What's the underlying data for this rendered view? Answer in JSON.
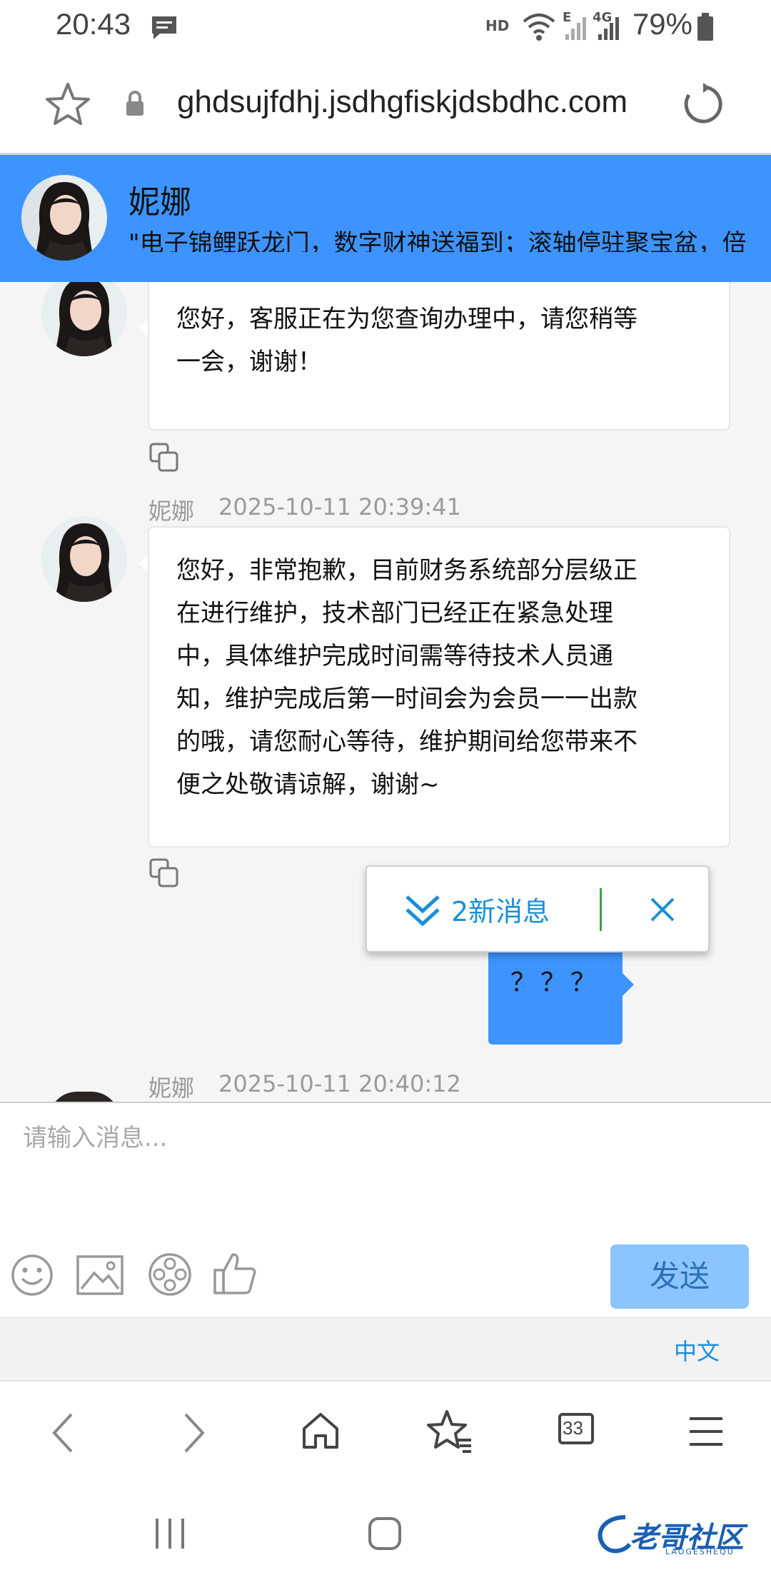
{
  "status_bar": {
    "time": "20:43",
    "network_label": "HD",
    "network_type_label": "4G",
    "edge_label": "E",
    "battery_percent": "79%"
  },
  "url_bar": {
    "url": "ghdsujfdhj.jsdhgfiskjdsbdhc.com"
  },
  "chat_header": {
    "agent_name": "妮娜",
    "marquee_text": "\"电子锦鲤跃龙门，数字财神送福到；滚轴停驻聚宝盆，倍"
  },
  "messages": [
    {
      "sender": "妮娜",
      "timestamp": "",
      "text": "您好，客服正在为您查询办理中，请您稍等一会，谢谢！",
      "lines": [
        "您好，客服正在为您查询办理中，请您稍等",
        "一会，谢谢！"
      ]
    },
    {
      "sender": "妮娜",
      "timestamp": "2025-10-11 20:39:41",
      "text": "您好，非常抱歉，目前财务系统部分层级正在进行维护，技术部门已经正在紧急处理中，具体维护完成时间需等待技术人员通知，维护完成后第一时间会为会员一一出款的哦，请您耐心等待，维护期间给您带来不便之处敬请谅解，谢谢~",
      "lines": [
        "您好，非常抱歉，目前财务系统部分层级正",
        "在进行维护，技术部门已经正在紧急处理",
        "中，具体维护完成时间需等待技术人员通",
        "知，维护完成后第一时间会为会员一一出款",
        "的哦，请您耐心等待，维护期间给您带来不",
        "便之处敬请谅解，谢谢~"
      ]
    },
    {
      "sender": "me",
      "text": "？？？"
    },
    {
      "sender": "妮娜",
      "timestamp": "2025-10-11 20:40:12"
    }
  ],
  "new_message_pill": {
    "label": "2新消息"
  },
  "composer": {
    "placeholder": "请输入消息...",
    "send_label": "发送"
  },
  "language": {
    "label": "中文"
  },
  "browser_toolbar": {
    "tabs_count": "33"
  },
  "watermark": {
    "text": "老哥社区",
    "subtext": "LAOGESHEQU"
  },
  "colors": {
    "header_bg": "#3d94ff",
    "my_bubble": "#3d94ff",
    "send_button": "#8cc4ff",
    "accent_link": "#1a8fd8",
    "pill_divider": "#3aa33a"
  }
}
